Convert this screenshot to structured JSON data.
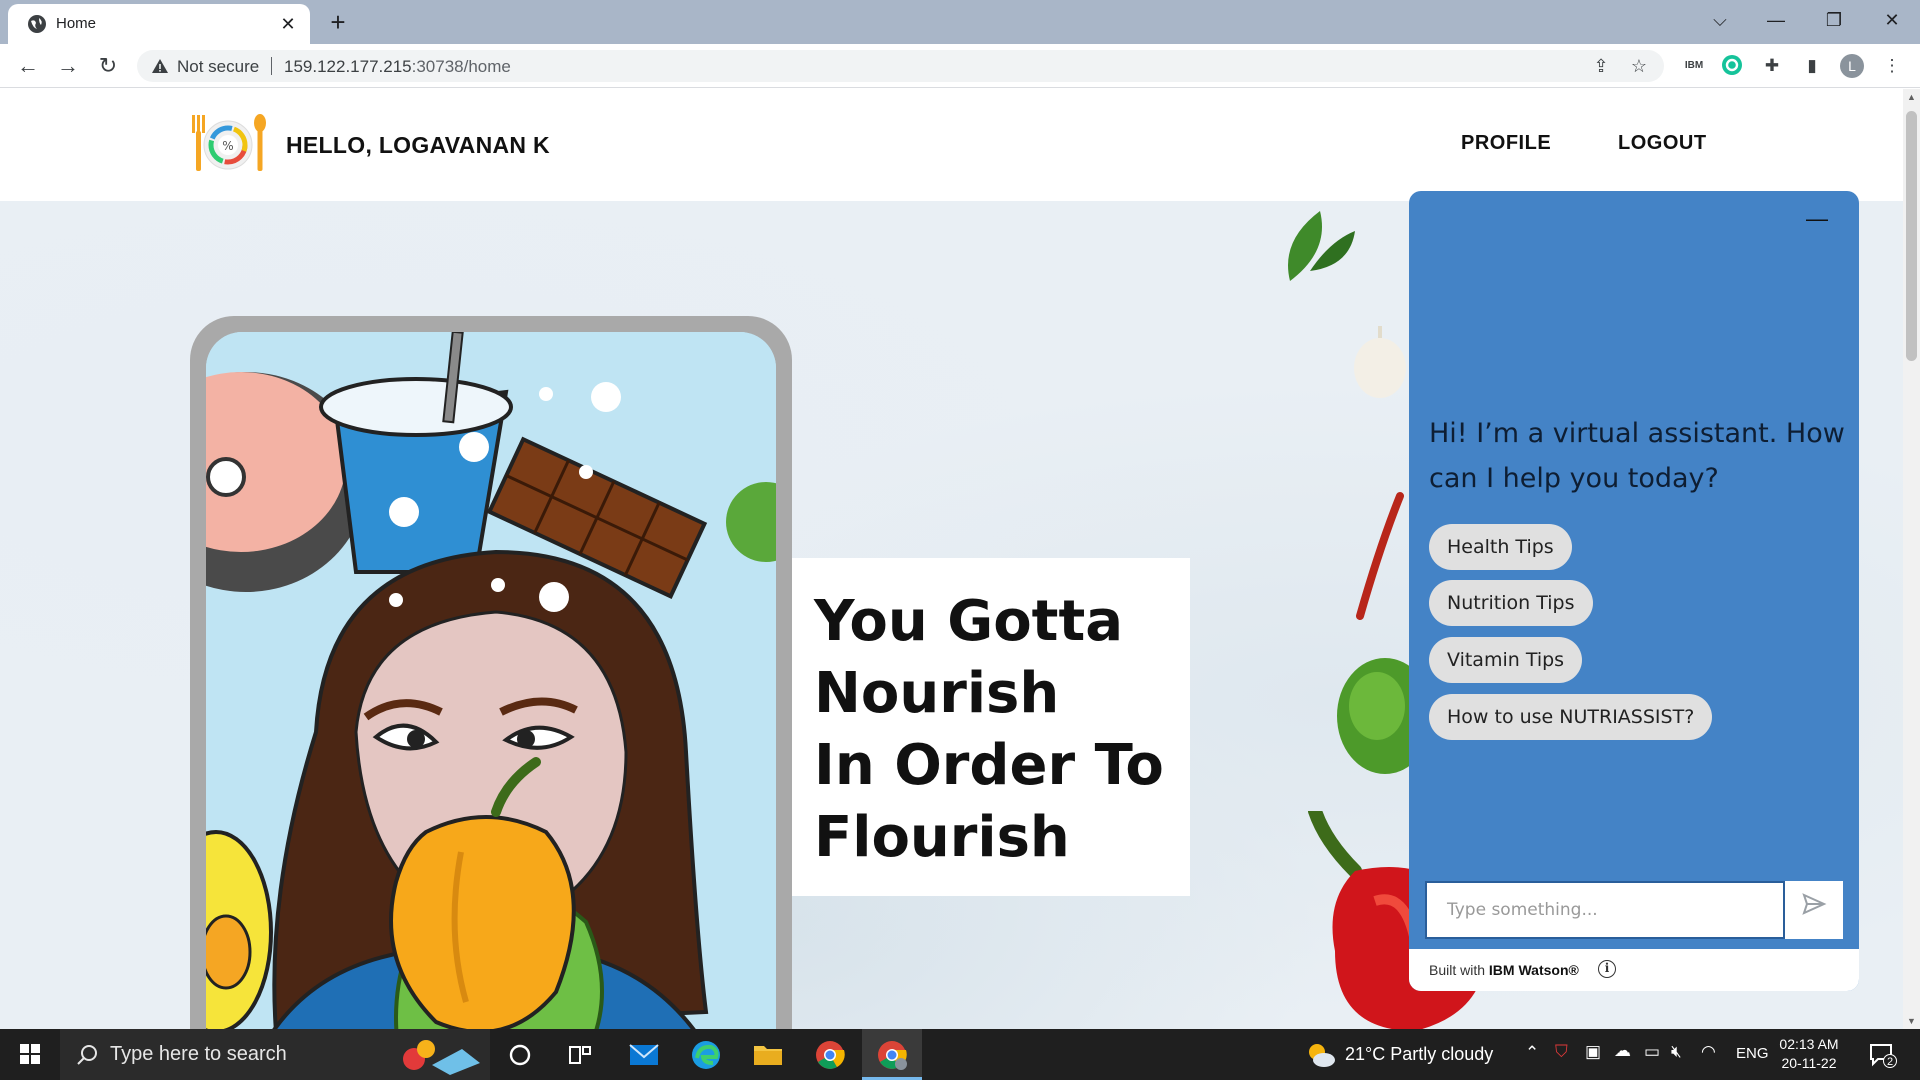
{
  "browser": {
    "tab_title": "Home",
    "tab_close": "✕",
    "new_tab": "+",
    "not_secure": "Not secure",
    "url_host": "159.122.177.215",
    "url_rest": ":30738/home",
    "profile_initial": "L"
  },
  "header": {
    "greeting": "HELLO, LOGAVANAN K",
    "nav": {
      "profile": "PROFILE",
      "logout": "LOGOUT"
    }
  },
  "hero": {
    "quote_lines": [
      "You Gotta",
      "Nourish",
      "In Order To",
      "Flourish"
    ]
  },
  "chat": {
    "minimize": "—",
    "greeting": "Hi! I’m a virtual assistant. How can I help you today?",
    "options": [
      "Health Tips",
      "Nutrition Tips",
      "Vitamin Tips",
      "How to use NUTRIASSIST?"
    ],
    "input_placeholder": "Type something...",
    "footer_prefix": "Built with",
    "footer_brand": "IBM Watson®",
    "info": "i"
  },
  "taskbar": {
    "search_placeholder": "Type here to search",
    "weather": "21°C  Partly cloudy",
    "language": "ENG",
    "time": "02:13 AM",
    "date": "20-11-22",
    "notification_count": "2"
  },
  "colors": {
    "chat_bg": "#4483c6",
    "chip_bg": "#e0e0e0",
    "taskbar_bg": "#1f1f1f",
    "tabstrip_bg": "#a9b6c8"
  }
}
